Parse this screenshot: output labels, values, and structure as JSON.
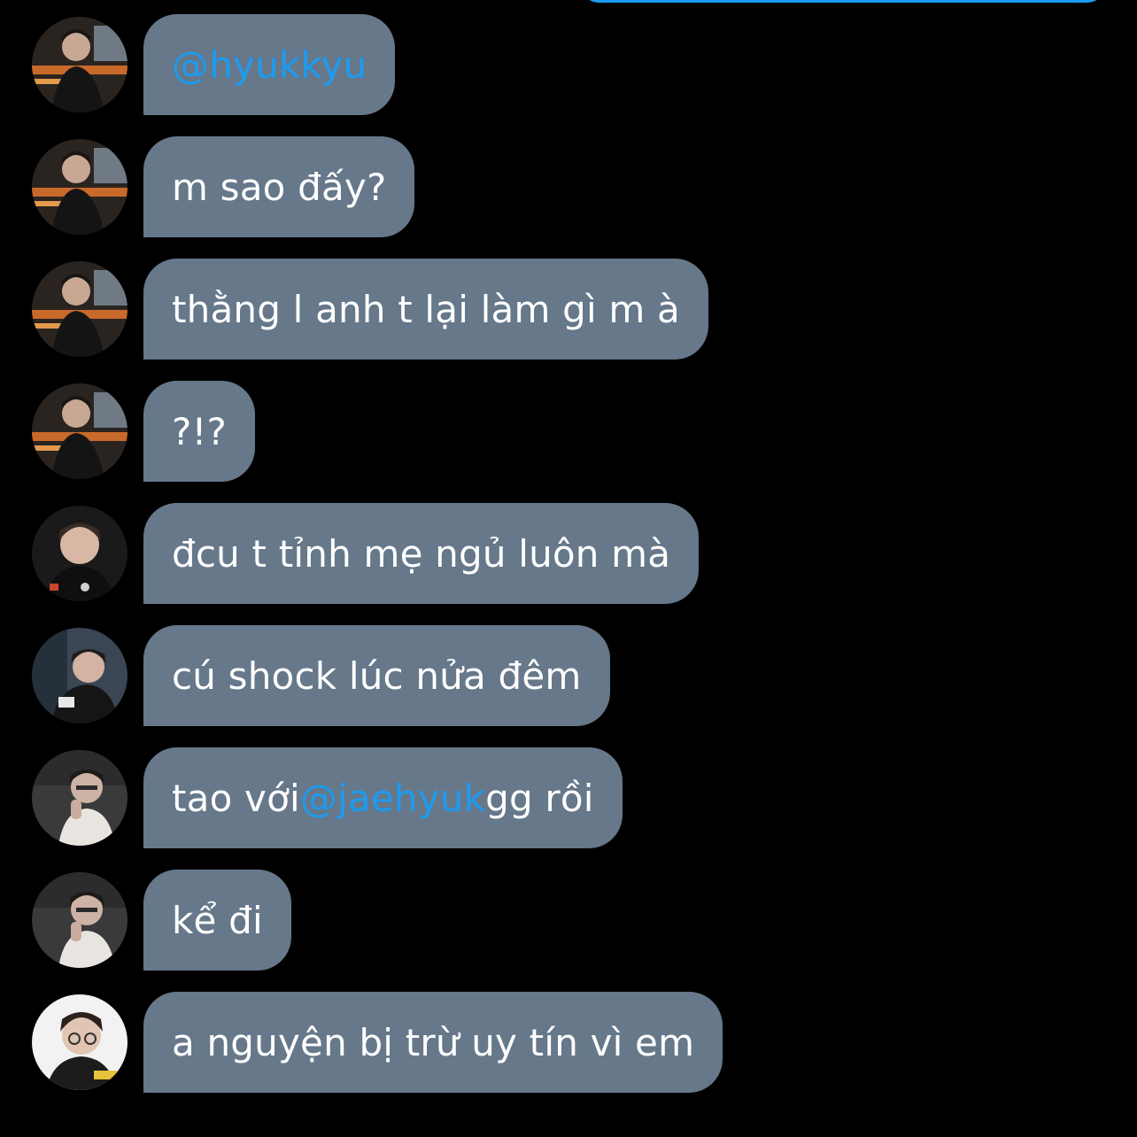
{
  "colors": {
    "background": "#000000",
    "bubble": "#66788a",
    "text": "#ffffff",
    "mention": "#1d9bf0",
    "sent_bubble": "#1d9bf0"
  },
  "messages": [
    {
      "avatar": "user-a-avatar",
      "mention": "@hyukkyu"
    },
    {
      "avatar": "user-a-avatar",
      "text": "m sao đấy?"
    },
    {
      "avatar": "user-a-avatar",
      "text": "thằng l anh t lại làm gì m à"
    },
    {
      "avatar": "user-a-avatar",
      "text": "?!?"
    },
    {
      "avatar": "user-b-avatar",
      "text": "đcu t tỉnh mẹ ngủ luôn mà"
    },
    {
      "avatar": "user-c-avatar",
      "text": "cú shock lúc nửa đêm"
    },
    {
      "avatar": "user-d-avatar",
      "before": "tao với ",
      "mention": "@jaehyuk",
      "after": " gg rồi"
    },
    {
      "avatar": "user-d-avatar",
      "text": "kể đi"
    },
    {
      "avatar": "user-e-avatar",
      "text": "a nguyện bị trừ uy tín vì em"
    }
  ]
}
